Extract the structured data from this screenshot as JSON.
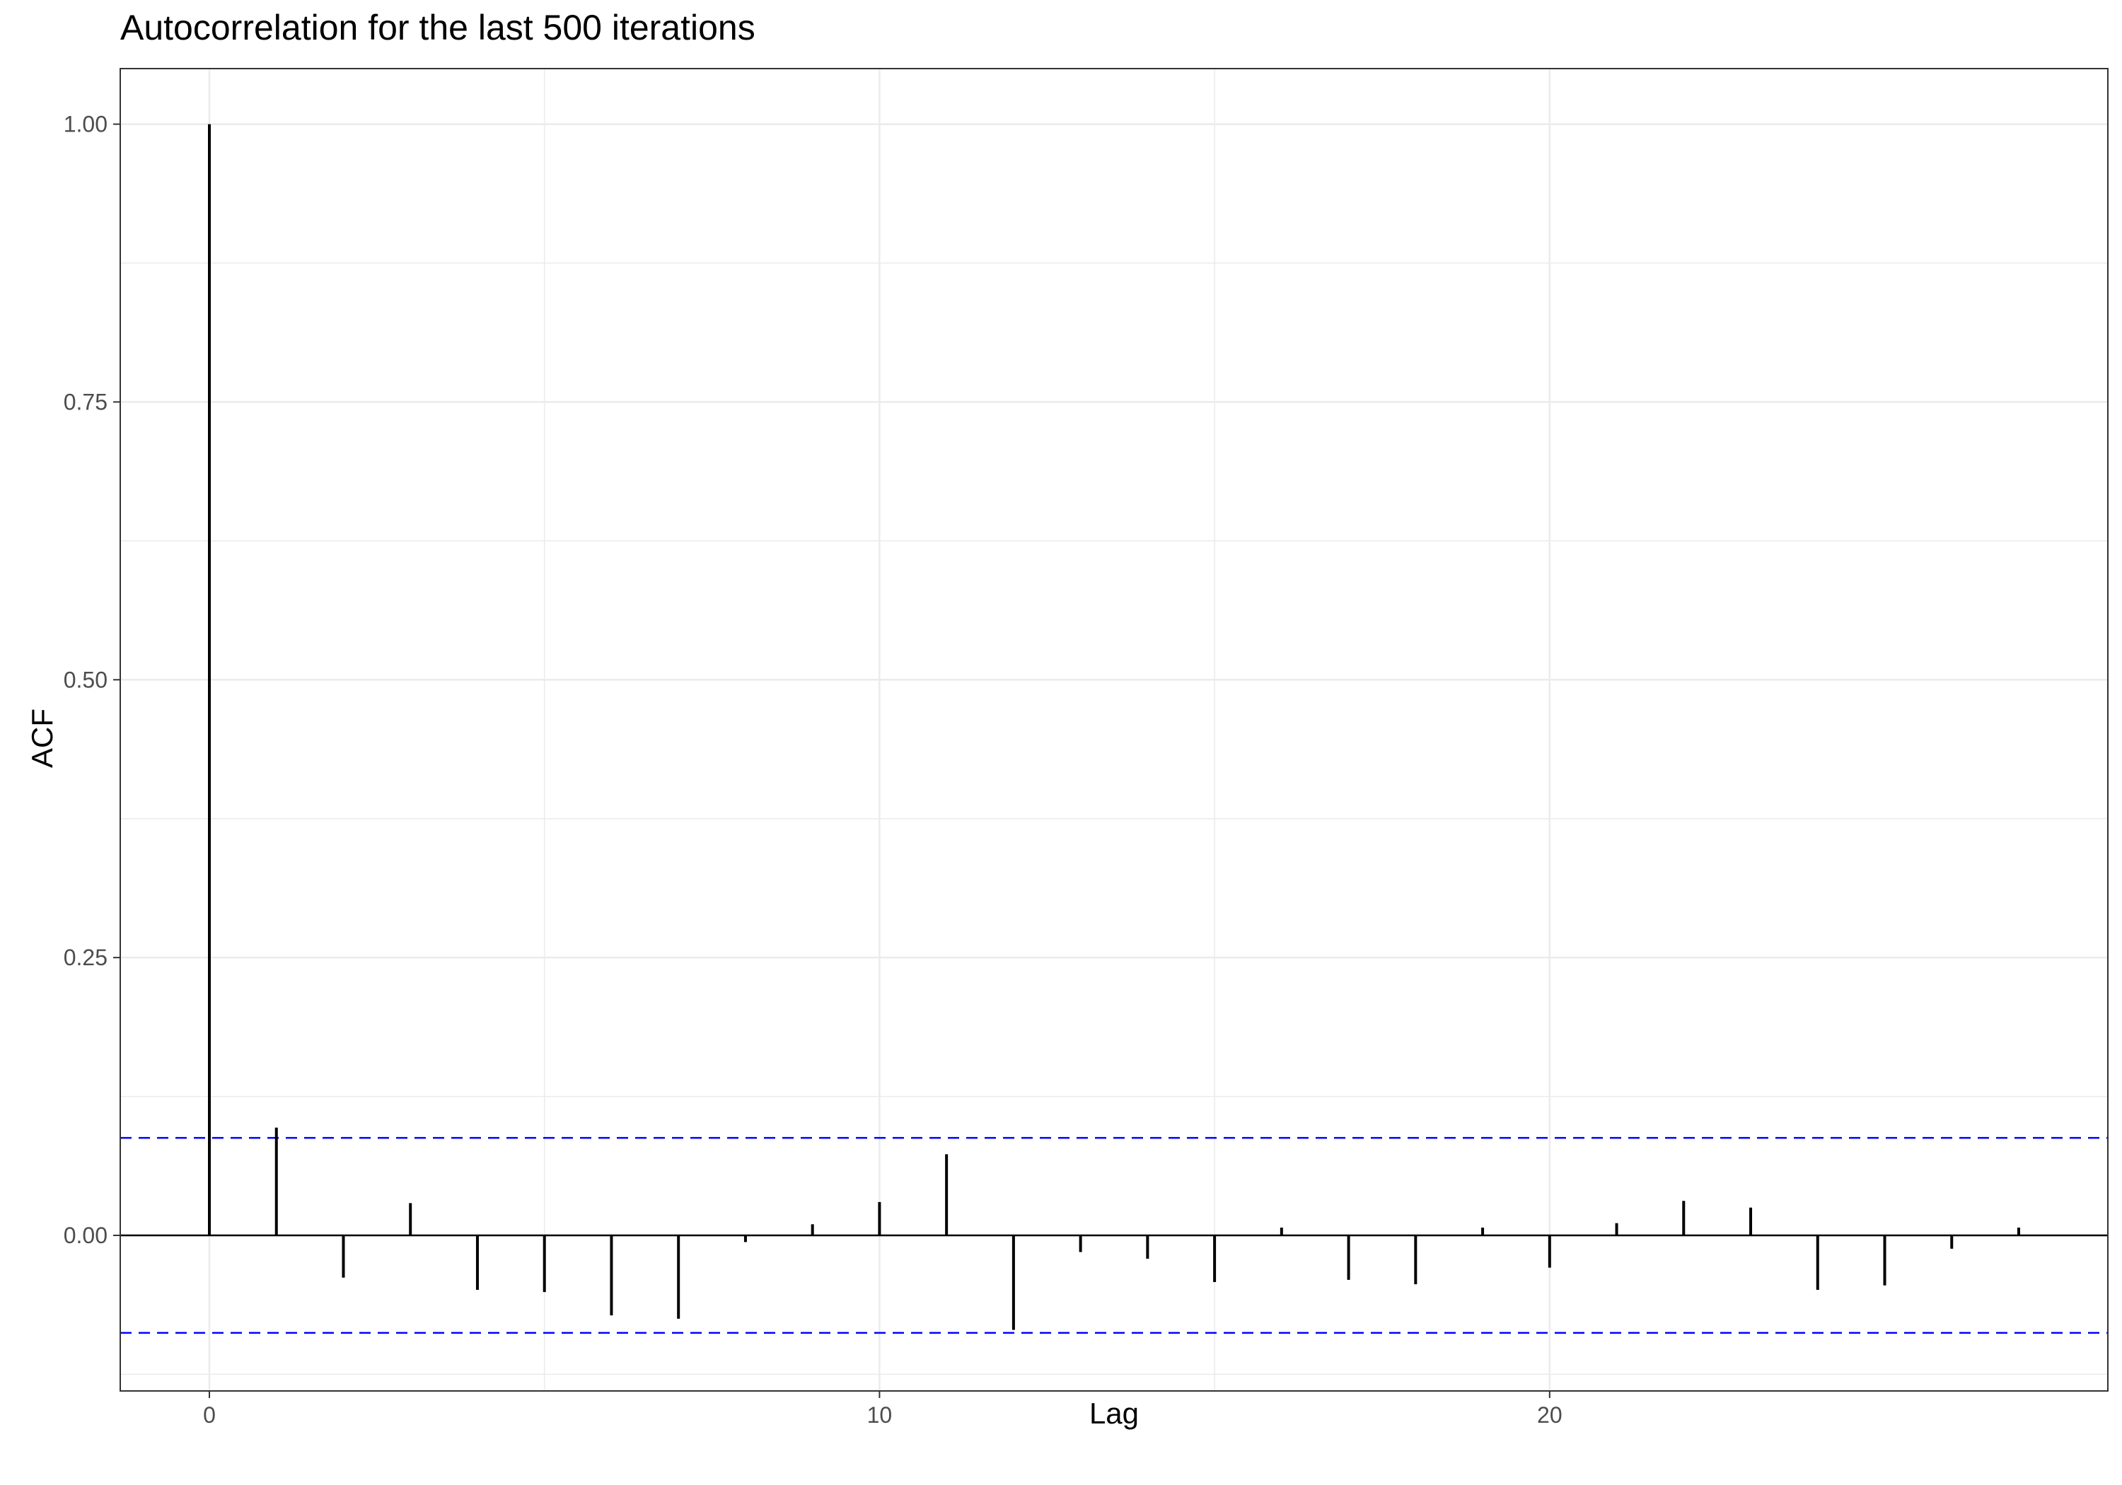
{
  "chart_data": {
    "type": "bar",
    "title": "Autocorrelation for the last 500 iterations",
    "xlabel": "Lag",
    "ylabel": "ACF",
    "xlim": [
      -1.33,
      28.33
    ],
    "ylim": [
      -0.14,
      1.05
    ],
    "x_ticks": [
      0,
      10,
      20
    ],
    "y_ticks": [
      0.0,
      0.25,
      0.5,
      0.75,
      1.0
    ],
    "y_tick_labels": [
      "0.00",
      "0.25",
      "0.50",
      "0.75",
      "1.00"
    ],
    "grid": true,
    "lags": [
      0,
      1,
      2,
      3,
      4,
      5,
      6,
      7,
      8,
      9,
      10,
      11,
      12,
      13,
      14,
      15,
      16,
      17,
      18,
      19,
      20,
      21,
      22,
      23,
      24,
      25,
      26,
      27
    ],
    "values": [
      1.0,
      0.097,
      -0.038,
      0.029,
      -0.049,
      -0.051,
      -0.072,
      -0.075,
      -0.006,
      0.01,
      0.03,
      0.073,
      -0.085,
      -0.015,
      -0.021,
      -0.042,
      0.007,
      -0.04,
      -0.044,
      0.007,
      -0.029,
      0.011,
      0.031,
      0.025,
      -0.049,
      -0.045,
      -0.012,
      0.007
    ],
    "confidence_bound": 0.0877,
    "colors": {
      "bars": "#000000",
      "bounds": "#0000ff",
      "grid": "#ebebeb",
      "panel_border": "#333333"
    }
  }
}
